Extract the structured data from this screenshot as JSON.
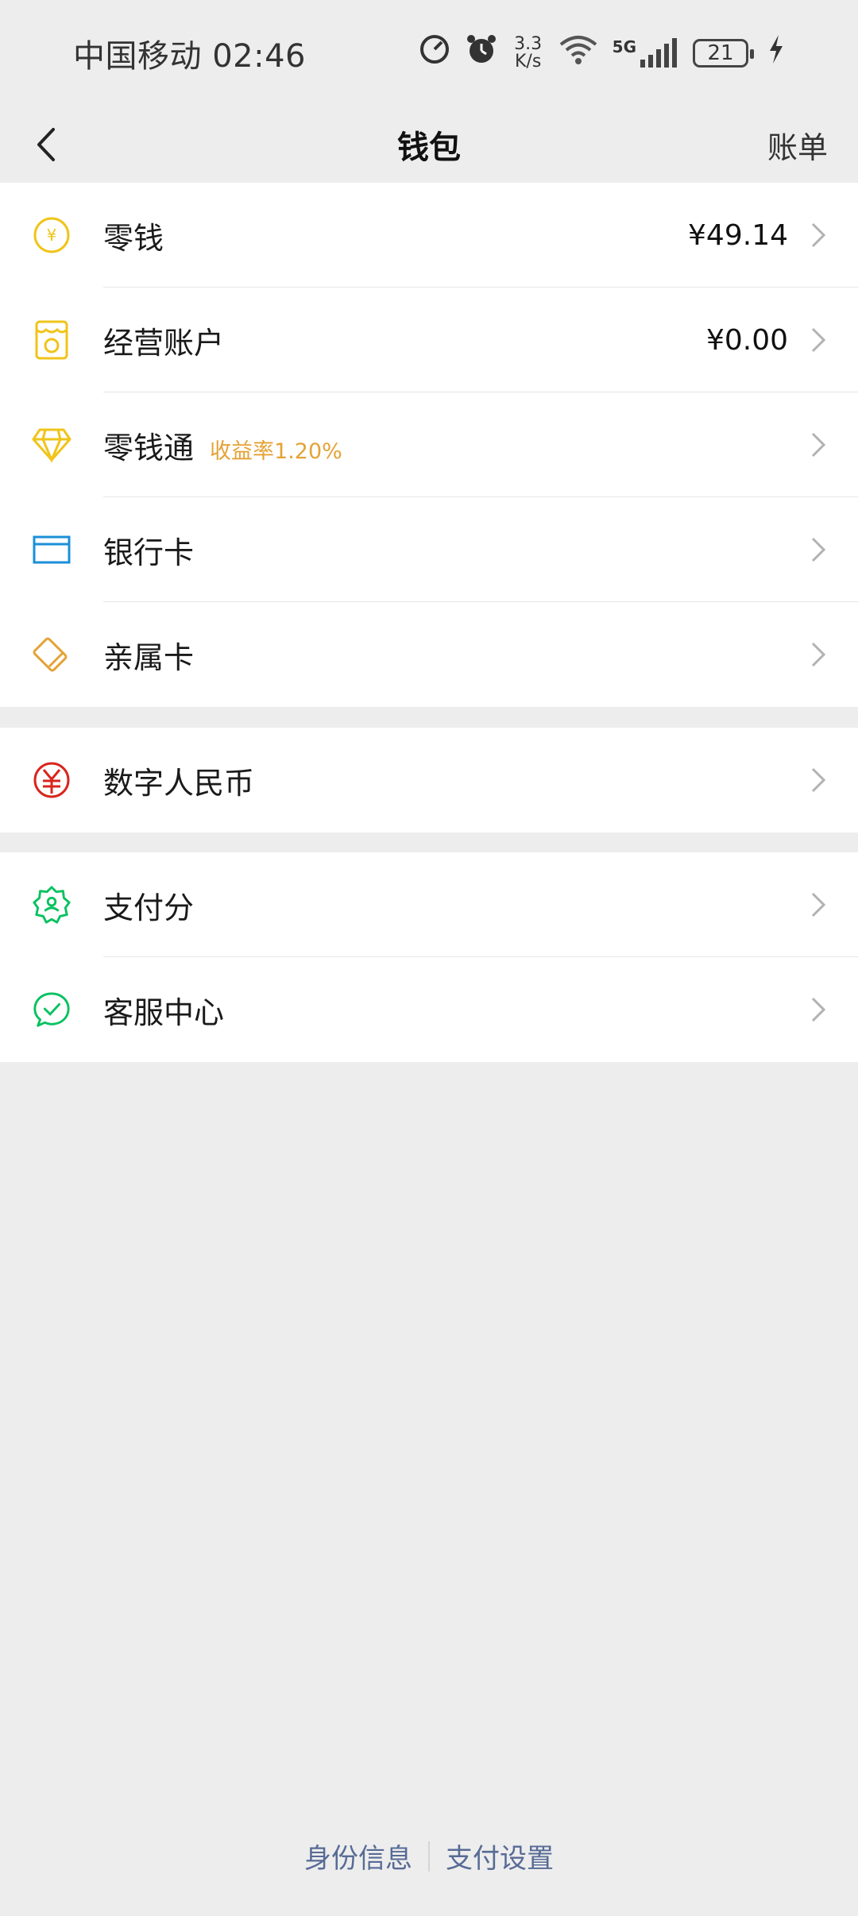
{
  "status_bar": {
    "carrier_time": "中国移动 02:46",
    "net_speed_top": "3.3",
    "net_speed_bottom": "K/s",
    "network": "5G",
    "battery": "21"
  },
  "nav": {
    "title": "钱包",
    "right_label": "账单"
  },
  "group1": [
    {
      "label": "零钱",
      "value": "¥49.14",
      "icon": "yuan-coin-icon",
      "color": "#f0c419"
    },
    {
      "label": "经营账户",
      "value": "¥0.00",
      "icon": "business-account-icon",
      "color": "#f0c419"
    },
    {
      "label": "零钱通",
      "tag": "收益率1.20%",
      "icon": "diamond-icon",
      "color": "#f0c419"
    },
    {
      "label": "银行卡",
      "icon": "bank-card-icon",
      "color": "#1b8fd8"
    },
    {
      "label": "亲属卡",
      "icon": "family-card-icon",
      "color": "#e5a236"
    }
  ],
  "group2": [
    {
      "label": "数字人民币",
      "icon": "digital-rmb-icon",
      "color": "#d9251d"
    }
  ],
  "group3": [
    {
      "label": "支付分",
      "icon": "payment-score-icon",
      "color": "#07c160"
    },
    {
      "label": "客服中心",
      "icon": "customer-service-icon",
      "color": "#07c160"
    }
  ],
  "footer": {
    "identity": "身份信息",
    "settings": "支付设置"
  }
}
